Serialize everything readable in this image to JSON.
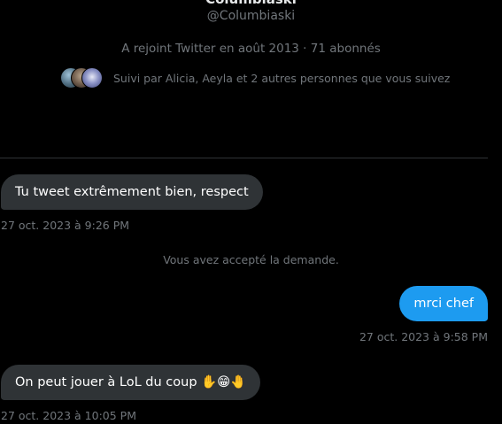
{
  "profile": {
    "display_name": "Columbiaski",
    "handle": "@Columbiaski",
    "joined_text": "A rejoint Twitter en août 2013 · 71 abonnés",
    "followed_by_text": "Suivi par Alicia, Aeyla et 2 autres personnes que vous suivez"
  },
  "conversation": {
    "system_message": "Vous avez accepté la demande.",
    "messages": [
      {
        "direction": "incoming",
        "text": "Tu tweet extrêmement bien, respect",
        "timestamp": "27 oct. 2023 à 9:26 PM"
      },
      {
        "direction": "outgoing",
        "text": "mrci chef",
        "timestamp": "27 oct. 2023 à 9:58 PM"
      },
      {
        "direction": "incoming",
        "text": "On peut jouer à LoL du coup ✋😁🤚",
        "timestamp": "27 oct. 2023 à 10:05 PM"
      }
    ]
  },
  "colors": {
    "background": "#000000",
    "incoming_bubble": "#2f3336",
    "outgoing_bubble": "#1d9bf0",
    "secondary_text": "#71767b",
    "divider": "#2f3336"
  }
}
